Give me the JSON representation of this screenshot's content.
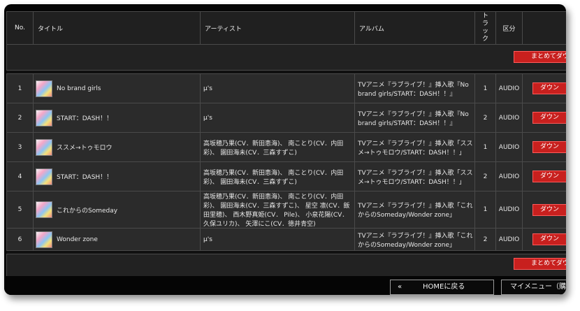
{
  "table": {
    "headers": {
      "no": "No.",
      "title": "タイトル",
      "artist": "アーティスト",
      "album": "アルバム",
      "track": "トラック",
      "type": "区分"
    },
    "bulk_download_label": "まとめてダウンロ",
    "download_label": "ダウン",
    "rows": [
      {
        "no": "1",
        "title": "No brand girls",
        "artist": "μ's",
        "album": "TVアニメ『ラブライブ！』挿入歌『No brand girls/START：DASH！！』",
        "track": "1",
        "type": "AUDIO"
      },
      {
        "no": "2",
        "title": "START：DASH！！",
        "artist": "μ's",
        "album": "TVアニメ『ラブライブ！』挿入歌『No brand girls/START：DASH！！』",
        "track": "2",
        "type": "AUDIO"
      },
      {
        "no": "3",
        "title": "ススメ→トゥモロウ",
        "artist": "高坂穂乃果(CV．新田恵海)、 南ことり(CV．内田彩)、 園田海未(CV．三森すずこ)",
        "album": "TVアニメ『ラブライブ！』挿入歌「ススメ→トゥモロウ/START：DASH！！」",
        "track": "1",
        "type": "AUDIO"
      },
      {
        "no": "4",
        "title": "START：DASH！！",
        "artist": "高坂穂乃果(CV．新田恵海)、 南ことり(CV．内田彩)、 園田海未(CV．三森すずこ)",
        "album": "TVアニメ『ラブライブ！』挿入歌「ススメ→トゥモロウ/START：DASH！！」",
        "track": "2",
        "type": "AUDIO"
      },
      {
        "no": "5",
        "title": "これからのSomeday",
        "artist": "高坂穂乃果(CV．新田恵海)、 南ことり(CV．内田彩)、 園田海未(CV．三森すずこ)、 星空 凛(CV．飯田里穂)、 西木野真姫(CV． Pile)、 小泉花陽(CV．久保ユリカ)、 矢澤にこ(CV．徳井青空)",
        "album": "TVアニメ『ラブライブ！』挿入歌「これからのSomeday/Wonder zone」",
        "track": "1",
        "type": "AUDIO"
      },
      {
        "no": "6",
        "title": "Wonder zone",
        "artist": "μ's",
        "album": "TVアニメ『ラブライブ！』挿入歌「これからのSomeday/Wonder zone」",
        "track": "2",
        "type": "AUDIO"
      }
    ]
  },
  "footer": {
    "home_arrow": "«",
    "home_label": "HOMEに戻る",
    "mymenu_label": "マイメニュー（購入"
  },
  "colors": {
    "download_red": "#c8201e",
    "background": "#101010"
  }
}
